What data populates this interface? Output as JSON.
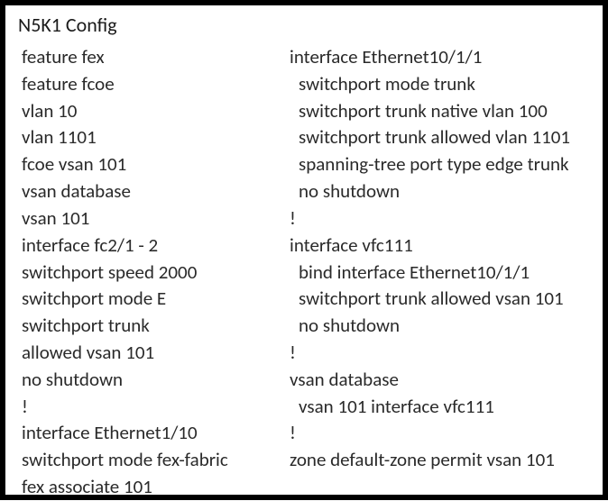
{
  "title": "N5K1 Config",
  "left_column": [
    {
      "text": "feature fex",
      "indent": false
    },
    {
      "text": "feature fcoe",
      "indent": false
    },
    {
      "text": "vlan 10",
      "indent": false
    },
    {
      "text": "vlan 1101",
      "indent": false
    },
    {
      "text": "fcoe vsan 101",
      "indent": false
    },
    {
      "text": "vsan database",
      "indent": false
    },
    {
      "text": "vsan 101",
      "indent": false
    },
    {
      "text": "interface fc2/1 - 2",
      "indent": false
    },
    {
      "text": "switchport speed 2000",
      "indent": false
    },
    {
      "text": "switchport mode E",
      "indent": false
    },
    {
      "text": "switchport trunk",
      "indent": false
    },
    {
      "text": "allowed vsan 101",
      "indent": false
    },
    {
      "text": "no shutdown",
      "indent": false
    },
    {
      "text": "!",
      "indent": false
    },
    {
      "text": "interface Ethernet1/10",
      "indent": false
    },
    {
      "text": "switchport mode fex-fabric",
      "indent": false
    },
    {
      "text": "fex associate 101",
      "indent": false
    }
  ],
  "right_column": [
    {
      "text": "interface Ethernet10/1/1",
      "indent": false
    },
    {
      "text": "switchport mode trunk",
      "indent": true
    },
    {
      "text": "switchport trunk native vlan 100",
      "indent": true
    },
    {
      "text": "switchport trunk allowed vlan 1101",
      "indent": true
    },
    {
      "text": "spanning-tree port type edge trunk",
      "indent": true
    },
    {
      "text": "no shutdown",
      "indent": true
    },
    {
      "text": "!",
      "indent": false
    },
    {
      "text": "interface vfc111",
      "indent": false
    },
    {
      "text": "bind interface Ethernet10/1/1",
      "indent": true
    },
    {
      "text": "switchport trunk allowed vsan 101",
      "indent": true
    },
    {
      "text": "no shutdown",
      "indent": true
    },
    {
      "text": "!",
      "indent": false
    },
    {
      "text": "vsan database",
      "indent": false
    },
    {
      "text": "vsan 101 interface vfc111",
      "indent": true
    },
    {
      "text": "!",
      "indent": false
    },
    {
      "text": "zone default-zone permit vsan 101",
      "indent": false
    }
  ]
}
